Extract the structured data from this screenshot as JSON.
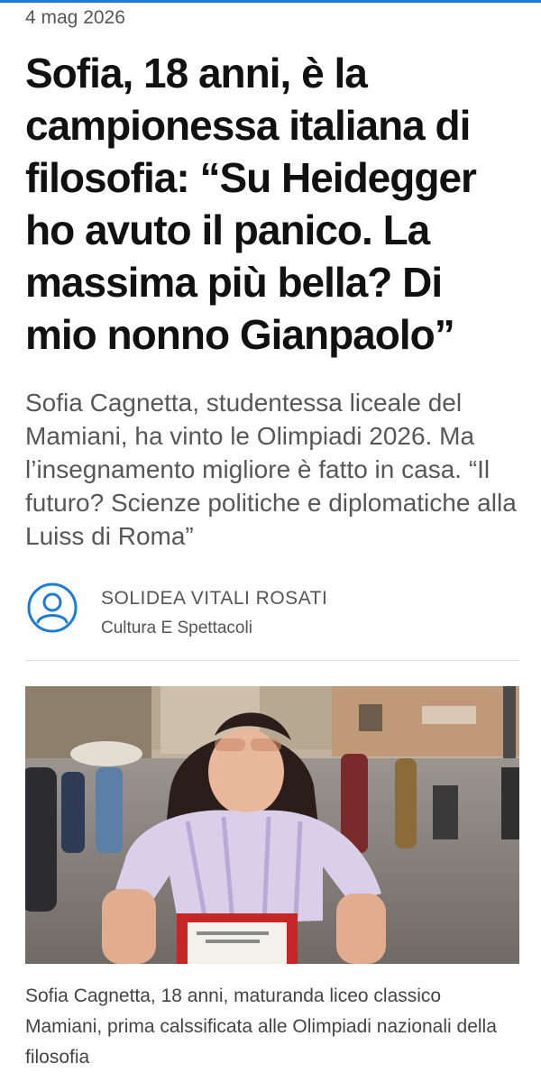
{
  "article": {
    "date": "4 mag 2026",
    "headline": "Sofia, 18 anni, è la campionessa italiana di filosofia: “Su Heidegger ho avuto il panico. La massima più bella? Di mio nonno Gianpaolo”",
    "summary": "Sofia Cagnetta, studentessa liceale del Mamiani, ha vinto le Olimpiadi 2026. Ma l’insegnamento migliore è fatto in casa. “Il futuro? Scienze politiche e diplomatiche alla Luiss di Roma”"
  },
  "author": {
    "name": "SOLIDEA VITALI ROSATI",
    "section": "Cultura E Spettacoli",
    "icon": "user-circle-icon"
  },
  "photo": {
    "caption": "Sofia Cagnetta, 18 anni, maturanda liceo classico Mamiani, prima calssificata alle Olimpiadi nazionali della filosofia"
  },
  "colors": {
    "accent": "#1e7bd6",
    "text": "#111111",
    "muted": "#575757"
  }
}
